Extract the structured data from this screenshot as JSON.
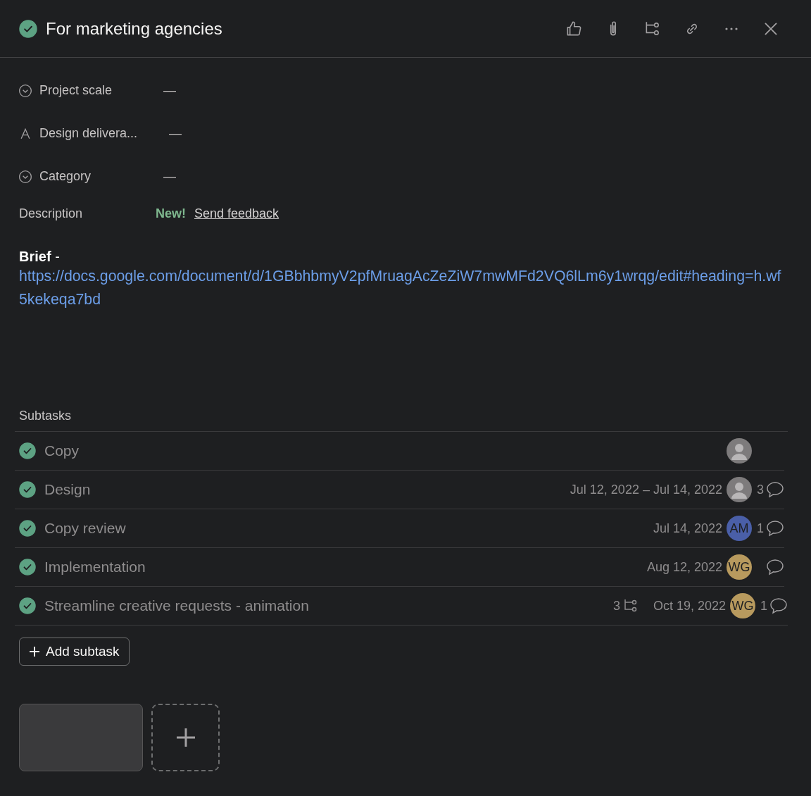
{
  "task": {
    "title": "For marketing agencies",
    "completed": true
  },
  "toolbar": [
    {
      "kind": "like"
    },
    {
      "kind": "attach"
    },
    {
      "kind": "subtask"
    },
    {
      "kind": "link"
    },
    {
      "kind": "more"
    },
    {
      "kind": "close"
    }
  ],
  "fields": [
    {
      "kind": "dropdown",
      "label": "Project scale",
      "value": "—"
    },
    {
      "kind": "text",
      "label": "Design delivera...",
      "value": "—"
    },
    {
      "kind": "dropdown",
      "label": "Category",
      "value": "—"
    }
  ],
  "description": {
    "label": "Description",
    "badge": "New!",
    "feedback_link": "Send feedback",
    "heading": "**Brief** -",
    "url": "https://docs.google.com/document/d/1GBbhbmyV2pfMruagAcZeZiW7mwMFd2VQ6lLm6y1wrqg/edit#heading=h.wf5kekeqa7bd"
  },
  "subtasks": {
    "title": "Subtasks",
    "items": [
      {
        "name": "Copy",
        "completed": true,
        "assignee": {
          "kind": "photo"
        }
      },
      {
        "name": "Design",
        "completed": true,
        "date": "Jul 12, 2022 – Jul 14, 2022",
        "assignee": {
          "kind": "photo"
        },
        "comment_icon": true,
        "comments": "3"
      },
      {
        "name": "Copy review",
        "completed": true,
        "date": "Jul 14, 2022",
        "assignee": {
          "kind": "initials",
          "initials": "AM",
          "color": "#4a5fa8"
        },
        "comment_icon": true,
        "comments": "1"
      },
      {
        "name": "Implementation",
        "completed": true,
        "date": "Aug 12, 2022",
        "assignee": {
          "kind": "initials",
          "initials": "WG",
          "color": "#b89a5e"
        },
        "comment_icon": true
      },
      {
        "name": "Streamline creative requests - animation",
        "completed": true,
        "subtask_count": "3",
        "date": "Oct 19, 2022",
        "assignee": {
          "kind": "initials",
          "initials": "WG",
          "color": "#b89a5e"
        },
        "comment_icon": true,
        "comments": "1"
      }
    ],
    "add_button": "Add subtask"
  },
  "attachments": [
    {
      "kind": "screenshot"
    },
    {
      "kind": "add"
    }
  ]
}
